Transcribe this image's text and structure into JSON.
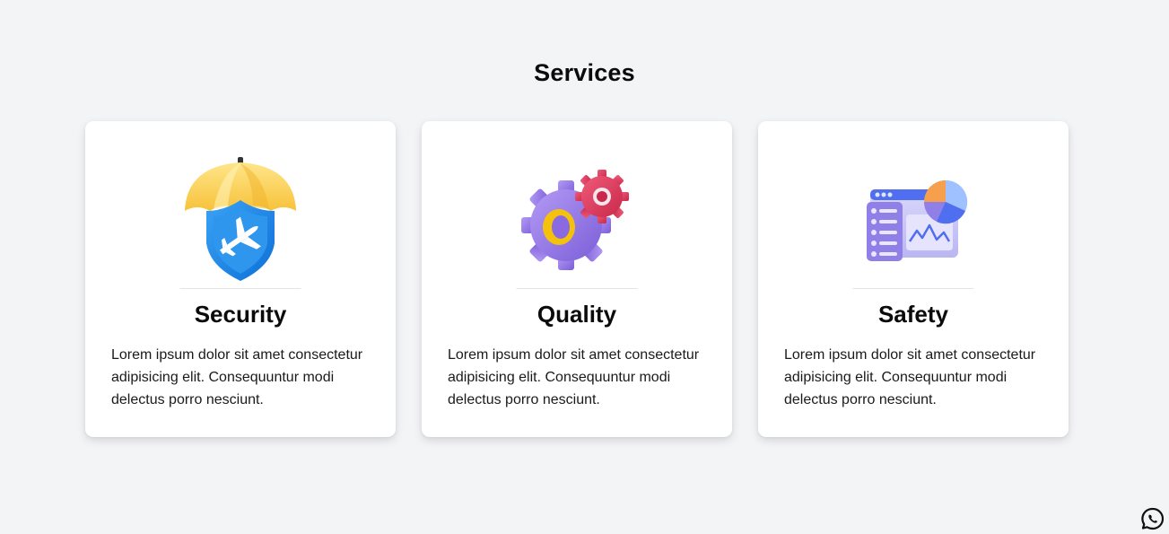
{
  "section": {
    "title": "Services"
  },
  "cards": [
    {
      "icon": "umbrella-shield-plane-icon",
      "title": "Security",
      "text": "Lorem ipsum dolor sit amet consectetur adipisicing elit. Consequuntur modi delectus porro nesciunt."
    },
    {
      "icon": "gears-icon",
      "title": "Quality",
      "text": "Lorem ipsum dolor sit amet consectetur adipisicing elit. Consequuntur modi delectus porro nesciunt."
    },
    {
      "icon": "dashboard-chart-icon",
      "title": "Safety",
      "text": "Lorem ipsum dolor sit amet consectetur adipisicing elit. Consequuntur modi delectus porro nesciunt."
    }
  ],
  "floating": {
    "icon": "whatsapp-icon"
  },
  "colors": {
    "background": "#f3f4f6",
    "card": "#ffffff",
    "shield_blue": "#1e88e5",
    "umbrella_yellow": "#ffd54f",
    "gear_purple": "#9b7fe8",
    "gear_red": "#e0415f",
    "ring_yellow": "#f4c20d",
    "chart_orange": "#f6a04d"
  }
}
